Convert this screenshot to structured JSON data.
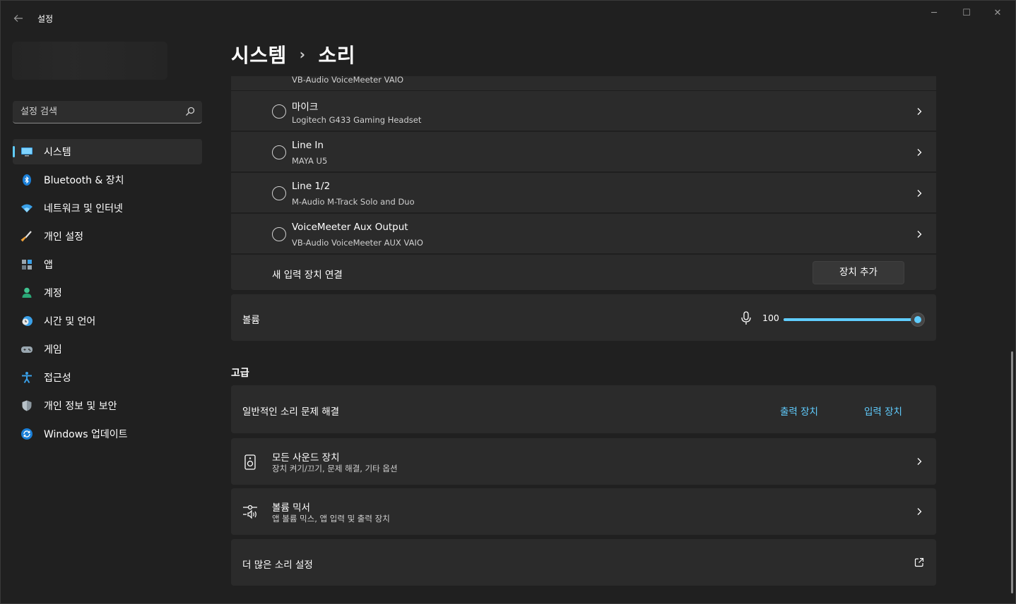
{
  "window": {
    "app_title": "설정",
    "back_icon": "back-arrow-icon",
    "controls": {
      "minimize": "─",
      "maximize": "☐",
      "close": "✕"
    }
  },
  "sidebar": {
    "search": {
      "placeholder": "설정 검색",
      "icon": "search-icon"
    },
    "items": [
      {
        "label": "시스템",
        "icon": "monitor-icon",
        "active": true
      },
      {
        "label": "Bluetooth & 장치",
        "icon": "bluetooth-icon"
      },
      {
        "label": "네트워크 및 인터넷",
        "icon": "wifi-icon"
      },
      {
        "label": "개인 설정",
        "icon": "brush-icon"
      },
      {
        "label": "앱",
        "icon": "apps-icon"
      },
      {
        "label": "계정",
        "icon": "person-icon"
      },
      {
        "label": "시간 및 언어",
        "icon": "clock-globe-icon"
      },
      {
        "label": "게임",
        "icon": "gamepad-icon"
      },
      {
        "label": "접근성",
        "icon": "accessibility-icon"
      },
      {
        "label": "개인 정보 및 보안",
        "icon": "shield-icon"
      },
      {
        "label": "Windows 업데이트",
        "icon": "update-icon"
      }
    ]
  },
  "header": {
    "breadcrumb_parent": "시스템",
    "breadcrumb_sep": "›",
    "breadcrumb_current": "소리"
  },
  "input_devices": {
    "partial_sub": "VB-Audio VoiceMeeter VAIO",
    "devices": [
      {
        "name": "마이크",
        "sub": "Logitech G433 Gaming Headset"
      },
      {
        "name": "Line In",
        "sub": "MAYA U5"
      },
      {
        "name": "Line 1/2",
        "sub": "M-Audio M-Track Solo and Duo"
      },
      {
        "name": "VoiceMeeter Aux Output",
        "sub": "VB-Audio VoiceMeeter AUX VAIO"
      }
    ],
    "add_label": "새 입력 장치 연결",
    "add_button": "장치 추가"
  },
  "volume": {
    "label": "볼륨",
    "value_text": "100",
    "level": 1.0,
    "icon": "microphone-icon"
  },
  "advanced": {
    "title": "고급",
    "troubleshoot": {
      "label": "일반적인 소리 문제 해결",
      "output_link": "출력 장치",
      "input_link": "입력 장치"
    },
    "all_devices": {
      "title": "모든 사운드 장치",
      "sub": "장치 켜기/끄기, 문제 해결, 기타 옵션",
      "icon": "speaker-icon"
    },
    "mixer": {
      "title": "볼륨 믹서",
      "sub": "앱 볼륨 믹스, 앱 입력 및 출력 장치",
      "icon": "mixer-icon"
    },
    "more": {
      "title": "더 많은 소리 설정",
      "icon": "external-link-icon"
    }
  },
  "colors": {
    "accent": "#60cdff",
    "background": "#202020",
    "card": "#2b2b2b"
  }
}
